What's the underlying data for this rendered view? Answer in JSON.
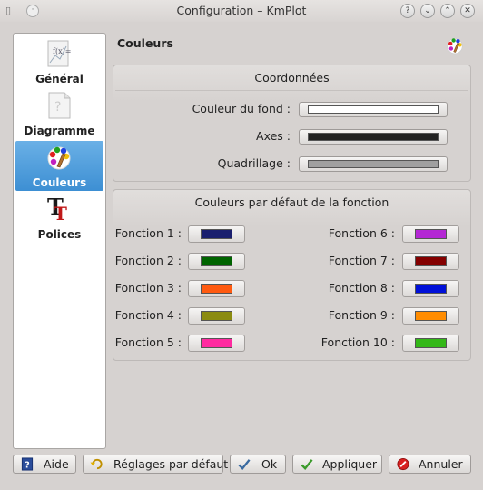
{
  "window": {
    "title": "Configuration – KmPlot",
    "buttons": [
      "?",
      "⌄",
      "⌃",
      "✕"
    ]
  },
  "sidebar": {
    "items": [
      {
        "label": "Général",
        "icon": "general-fx-icon"
      },
      {
        "label": "Diagramme",
        "icon": "diagram-page-icon"
      },
      {
        "label": "Couleurs",
        "icon": "color-palette-icon",
        "selected": true
      },
      {
        "label": "Polices",
        "icon": "fonts-icon"
      }
    ]
  },
  "page": {
    "title": "Couleurs",
    "icon": "color-palette-icon"
  },
  "coords": {
    "title": "Coordonnées",
    "rows": [
      {
        "label": "Couleur du fond :",
        "color": "#ffffff"
      },
      {
        "label": "Axes :",
        "color": "#222222"
      },
      {
        "label": "Quadrillage :",
        "color": "#a0a0a0"
      }
    ]
  },
  "functions": {
    "title": "Couleurs par défaut de la fonction",
    "left": [
      {
        "label": "Fonction 1 :",
        "color": "#1a1f6e"
      },
      {
        "label": "Fonction 2 :",
        "color": "#006400"
      },
      {
        "label": "Fonction 3 :",
        "color": "#ff5a10"
      },
      {
        "label": "Fonction 4 :",
        "color": "#8b8b10"
      },
      {
        "label": "Fonction 5 :",
        "color": "#ff2aa0"
      }
    ],
    "right": [
      {
        "label": "Fonction 6 :",
        "color": "#b428d4"
      },
      {
        "label": "Fonction 7 :",
        "color": "#840000"
      },
      {
        "label": "Fonction 8 :",
        "color": "#0010d8"
      },
      {
        "label": "Fonction 9 :",
        "color": "#ff8c00"
      },
      {
        "label": "Fonction 10 :",
        "color": "#34b818"
      }
    ]
  },
  "buttons": {
    "help": "Aide",
    "defaults": "Réglages par défaut",
    "ok": "Ok",
    "apply": "Appliquer",
    "cancel": "Annuler"
  }
}
